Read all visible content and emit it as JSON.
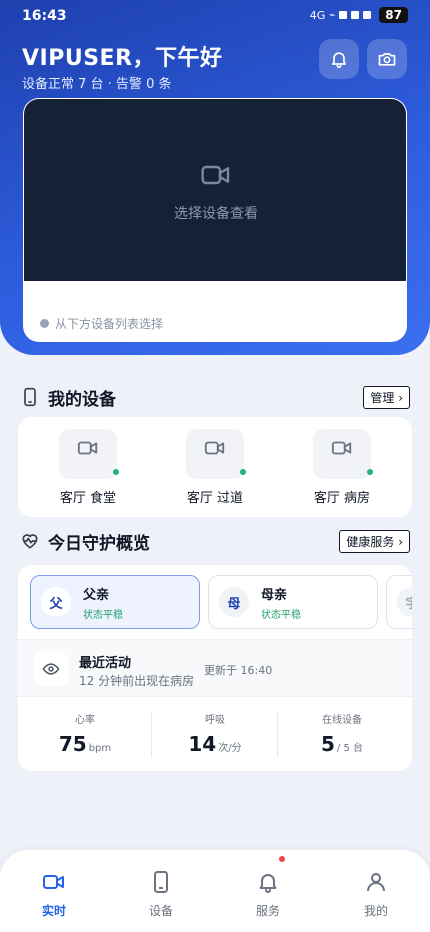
{
  "status_bar": {
    "time": "16:43",
    "network": "4G",
    "battery": "87"
  },
  "header": {
    "greeting": "VIPUSER，下午好",
    "summary": "设备正常 7 台 · 告警 0 条"
  },
  "video": {
    "placeholder": "选择设备查看",
    "hint": "从下方设备列表选择"
  },
  "devices_section": {
    "title": "我的设备",
    "manage_label": "管理 ›",
    "devices": [
      {
        "name": "客厅 食堂"
      },
      {
        "name": "客厅 过道"
      },
      {
        "name": "客厅 病房"
      }
    ]
  },
  "overview": {
    "title": "今日守护概览",
    "service_label": "健康服务 ›",
    "people": [
      {
        "avatar": "父",
        "name": "父亲",
        "status": "状态平稳"
      },
      {
        "avatar": "母",
        "name": "母亲",
        "status": "状态平稳"
      },
      {
        "avatar": "宇"
      }
    ],
    "activity": {
      "title": "最近活动",
      "desc": "12 分钟前出现在病房",
      "updated": "更新于 16:40"
    },
    "metrics": [
      {
        "label": "心率",
        "value": "75",
        "unit": "bpm"
      },
      {
        "label": "呼吸",
        "value": "14",
        "unit": "次/分"
      },
      {
        "label": "在线设备",
        "value": "5",
        "unit": "/ 5 台"
      }
    ]
  },
  "tabs": [
    {
      "label": "实时"
    },
    {
      "label": "设备"
    },
    {
      "label": "服务"
    },
    {
      "label": "我的"
    }
  ],
  "colors": {
    "primary": "#2563eb",
    "hero_start": "#1e40af",
    "online": "#22b07d",
    "alert": "#ef4444"
  }
}
